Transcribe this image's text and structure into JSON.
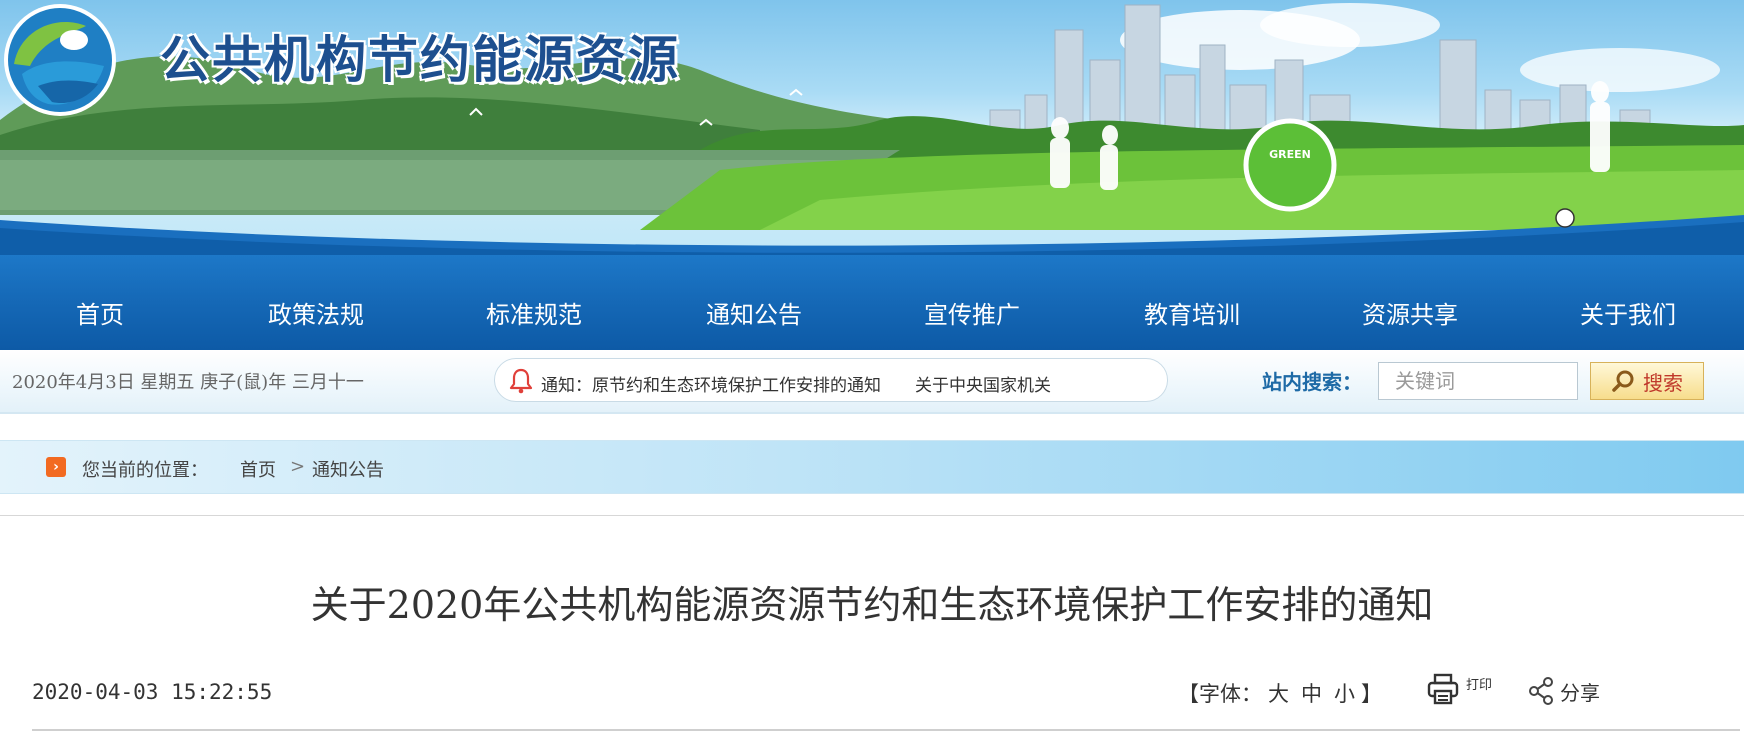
{
  "site": {
    "title": "公共机构节约能源资源",
    "banner_badge": "GREEN"
  },
  "nav": {
    "items": [
      "首页",
      "政策法规",
      "标准规范",
      "通知公告",
      "宣传推广",
      "教育培训",
      "资源共享",
      "关于我们"
    ]
  },
  "info": {
    "date": "2020年4月3日  星期五  庚子(鼠)年  三月十一",
    "notice_prefix": "通知：",
    "notice_items": [
      "原节约和生态环境保护工作安排的通知",
      "关于中央国家机关"
    ],
    "search_label": "站内搜索：",
    "search_placeholder": "关键词",
    "search_button": "搜索"
  },
  "breadcrumb": {
    "label": "您当前的位置：",
    "items": [
      "首页",
      "通知公告"
    ],
    "separator": ">"
  },
  "article": {
    "title": "关于2020年公共机构能源资源节约和生态环境保护工作安排的通知",
    "datetime": "2020-04-03 15:22:55",
    "font_open": "【字体：",
    "font_sizes": [
      "大",
      "中",
      "小"
    ],
    "font_close": "】",
    "print_label": "打印",
    "share_label": "分享"
  },
  "colors": {
    "nav_bg": "#1568b6",
    "site_title": "#1d4f8f",
    "breadcrumb_arrow": "#f26a21",
    "search_label": "#1e6aa6",
    "search_button_text": "#c0392b"
  },
  "icons": [
    "logo-icon",
    "bell-icon",
    "search-icon",
    "chevron-right-icon",
    "printer-icon",
    "share-icon"
  ]
}
